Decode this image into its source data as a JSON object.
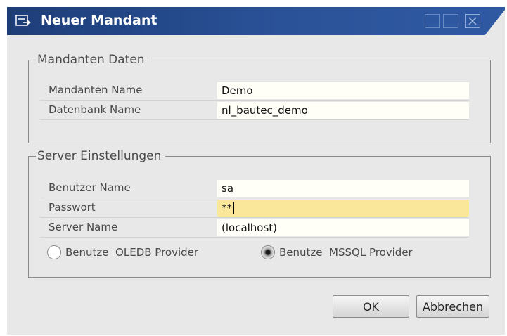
{
  "window": {
    "title": "Neuer Mandant"
  },
  "mandanten": {
    "group_title": "Mandanten Daten",
    "rows": [
      {
        "label": "Mandanten Name",
        "value": "Demo"
      },
      {
        "label": "Datenbank Name",
        "value": "nl_bautec_demo"
      }
    ]
  },
  "server": {
    "group_title": "Server Einstellungen",
    "rows": [
      {
        "label": "Benutzer Name",
        "value": "sa"
      },
      {
        "label": "Passwort",
        "value": "**"
      },
      {
        "label": "Server Name",
        "value": "(localhost)"
      }
    ],
    "provider_options": [
      {
        "label": "Benutze  OLEDB Provider",
        "checked": false
      },
      {
        "label": "Benutze  MSSQL Provider",
        "checked": true
      }
    ]
  },
  "buttons": {
    "ok_label": "OK",
    "cancel_label": "Abbrechen"
  },
  "colors": {
    "titlebar": "#2a5298",
    "active_field": "#fbe79a",
    "dialog_background": "#e8e8e8"
  }
}
